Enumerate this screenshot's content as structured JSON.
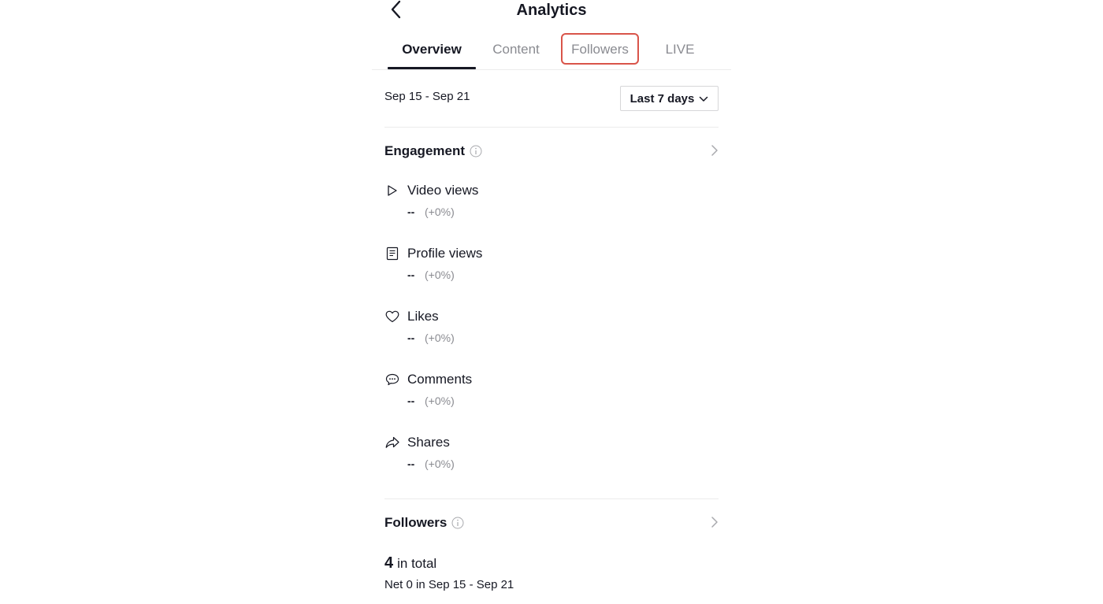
{
  "header": {
    "title": "Analytics",
    "back_icon": "chevron-left-icon"
  },
  "tabs": [
    {
      "label": "Overview",
      "active": true
    },
    {
      "label": "Content",
      "active": false
    },
    {
      "label": "Followers",
      "active": false,
      "highlighted": true
    },
    {
      "label": "LIVE",
      "active": false
    }
  ],
  "date_range": "Sep 15 - Sep 21",
  "period_select": {
    "label": "Last 7 days",
    "icon": "chevron-down-icon"
  },
  "engagement": {
    "title": "Engagement",
    "metrics": [
      {
        "label": "Video views",
        "value": "--",
        "change": "(+0%)",
        "icon": "play-icon"
      },
      {
        "label": "Profile views",
        "value": "--",
        "change": "(+0%)",
        "icon": "profile-doc-icon"
      },
      {
        "label": "Likes",
        "value": "--",
        "change": "(+0%)",
        "icon": "heart-icon"
      },
      {
        "label": "Comments",
        "value": "--",
        "change": "(+0%)",
        "icon": "comment-icon"
      },
      {
        "label": "Shares",
        "value": "--",
        "change": "(+0%)",
        "icon": "share-icon"
      }
    ]
  },
  "followers": {
    "title": "Followers",
    "total_count": "4",
    "total_suffix": "in total",
    "net_text": "Net 0 in Sep 15 - Sep 21"
  },
  "colors": {
    "text": "#161823",
    "muted": "#8a8b91",
    "highlight_border": "#d9544a",
    "divider": "#ececec"
  }
}
